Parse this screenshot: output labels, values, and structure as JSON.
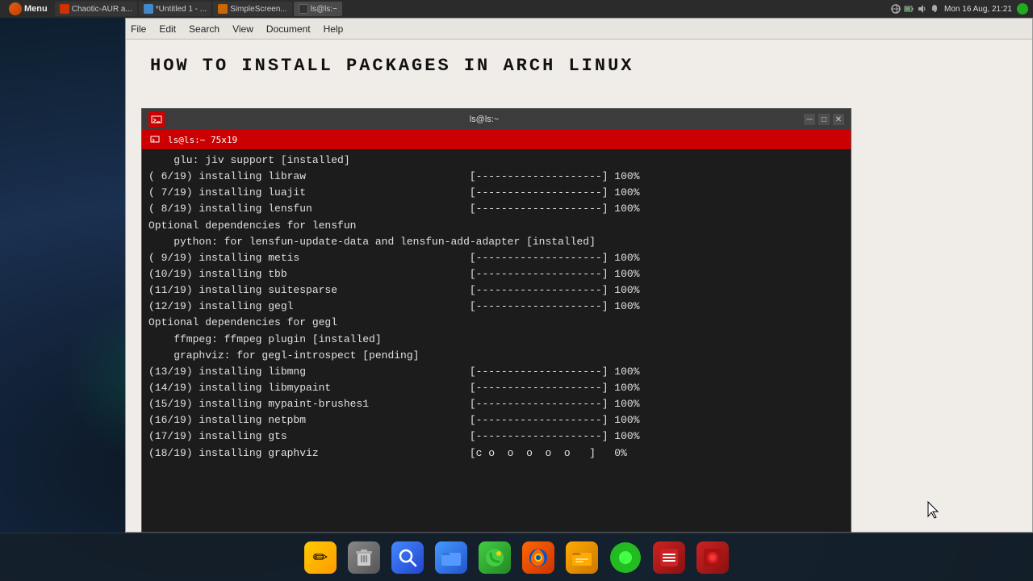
{
  "taskbar": {
    "menu_label": "Menu",
    "apps": [
      {
        "label": "Chaotic-AUR a...",
        "active": false,
        "icon_class": "icon-chaotic"
      },
      {
        "label": "*Untitled 1 - ...",
        "active": false,
        "icon_class": "icon-untitled"
      },
      {
        "label": "SimpleScreen...",
        "active": false,
        "icon_class": "icon-simplescreen"
      },
      {
        "label": "ls@ls:~",
        "active": true,
        "icon_class": "icon-terminal"
      }
    ],
    "clock": "Mon 16 Aug, 21:21"
  },
  "editor": {
    "menu_items": [
      "File",
      "Edit",
      "Search",
      "View",
      "Document",
      "Help"
    ],
    "title": "HOW TO INSTALL PACKAGES IN ARCH LINUX"
  },
  "terminal": {
    "title": "ls@ls:~",
    "tab_title": "ls@ls:~ 75x19",
    "lines": [
      "    glu: jiv support [installed]",
      "( 6/19) installing libraw                          [--------------------] 100%",
      "( 7/19) installing luajit                          [--------------------] 100%",
      "( 8/19) installing lensfun                         [--------------------] 100%",
      "Optional dependencies for lensfun",
      "    python: for lensfun-update-data and lensfun-add-adapter [installed]",
      "( 9/19) installing metis                           [--------------------] 100%",
      "(10/19) installing tbb                             [--------------------] 100%",
      "(11/19) installing suitesparse                     [--------------------] 100%",
      "(12/19) installing gegl                            [--------------------] 100%",
      "Optional dependencies for gegl",
      "    ffmpeg: ffmpeg plugin [installed]",
      "    graphviz: for gegl-introspect [pending]",
      "(13/19) installing libmng                          [--------------------] 100%",
      "(14/19) installing libmypaint                      [--------------------] 100%",
      "(15/19) installing mypaint-brushes1                [--------------------] 100%",
      "(16/19) installing netpbm                          [--------------------] 100%",
      "(17/19) installing gts                             [--------------------] 100%",
      "(18/19) installing graphviz                        [c o  o  o  o  o   ]   0%"
    ]
  },
  "dock": {
    "items": [
      {
        "name": "notes",
        "label": "✏",
        "class": "dock-notes"
      },
      {
        "name": "delete",
        "label": "🗑",
        "class": "dock-delete"
      },
      {
        "name": "search",
        "label": "🔍",
        "class": "dock-search"
      },
      {
        "name": "files-blue",
        "label": "📁",
        "class": "dock-files-blue"
      },
      {
        "name": "serpentine",
        "label": "🐍",
        "class": "dock-serpentine"
      },
      {
        "name": "firefox",
        "label": "🦊",
        "class": "dock-firefox"
      },
      {
        "name": "filemanager",
        "label": "📂",
        "class": "dock-filemanager"
      },
      {
        "name": "volume",
        "label": "●",
        "class": "dock-volume"
      },
      {
        "name": "taskmanager",
        "label": "📋",
        "class": "dock-taskman"
      },
      {
        "name": "record",
        "label": "⏺",
        "class": "dock-record"
      }
    ]
  }
}
